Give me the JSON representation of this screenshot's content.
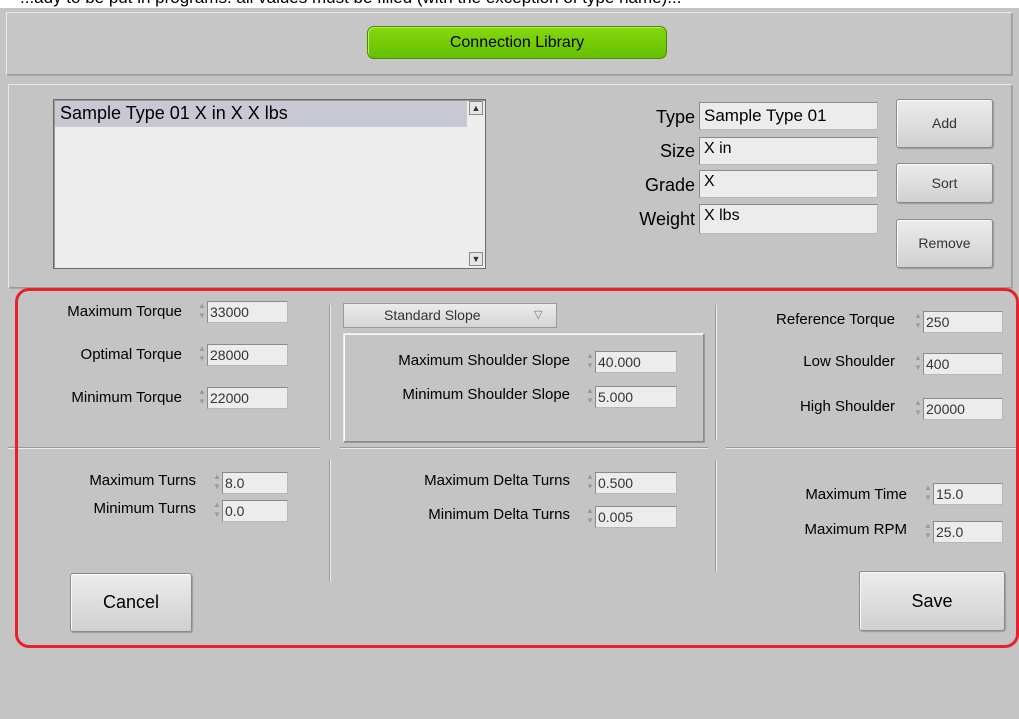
{
  "header_clip": "...ady to be put in programs. all values must be filled (with the exception of type name)...",
  "title_button": "Connection Library",
  "library": {
    "list_items": [
      "Sample Type 01 X in X X lbs"
    ],
    "fields": [
      {
        "label": "Type",
        "value": "Sample Type 01"
      },
      {
        "label": "Size",
        "value": "X in"
      },
      {
        "label": "Grade",
        "value": "X"
      },
      {
        "label": "Weight",
        "value": "X lbs"
      }
    ],
    "buttons": {
      "add": "Add",
      "sort": "Sort",
      "remove": "Remove"
    }
  },
  "torque": {
    "max": {
      "label": "Maximum Torque",
      "value": "33000"
    },
    "opt": {
      "label": "Optimal Torque",
      "value": "28000"
    },
    "min": {
      "label": "Minimum Torque",
      "value": "22000"
    }
  },
  "slope": {
    "dropdown": "Standard Slope",
    "max": {
      "label": "Maximum Shoulder Slope",
      "value": "40.000"
    },
    "min": {
      "label": "Minimum Shoulder Slope",
      "value": "5.000"
    }
  },
  "reference": {
    "ref": {
      "label": "Reference Torque",
      "value": "250"
    },
    "low": {
      "label": "Low Shoulder",
      "value": "400"
    },
    "high": {
      "label": "High Shoulder",
      "value": "20000"
    }
  },
  "turns": {
    "max": {
      "label": "Maximum Turns",
      "value": "8.0"
    },
    "min": {
      "label": "Minimum Turns",
      "value": "0.0"
    }
  },
  "delta": {
    "max": {
      "label": "Maximum Delta Turns",
      "value": "0.500"
    },
    "min": {
      "label": "Minimum Delta Turns",
      "value": "0.005"
    }
  },
  "time": {
    "time": {
      "label": "Maximum Time",
      "value": "15.0"
    },
    "rpm": {
      "label": "Maximum RPM",
      "value": "25.0"
    }
  },
  "actions": {
    "cancel": "Cancel",
    "save": "Save"
  },
  "colors": {
    "title_green": "#72cc06",
    "highlight_red": "#e8202a",
    "panel_gray": "#c4c4c4"
  },
  "icons": {
    "spinner": "spin-arrows-icon",
    "dropdown": "triangle-down-icon",
    "scroll_up": "scroll-up-arrow-icon",
    "scroll_down": "scroll-down-arrow-icon"
  }
}
